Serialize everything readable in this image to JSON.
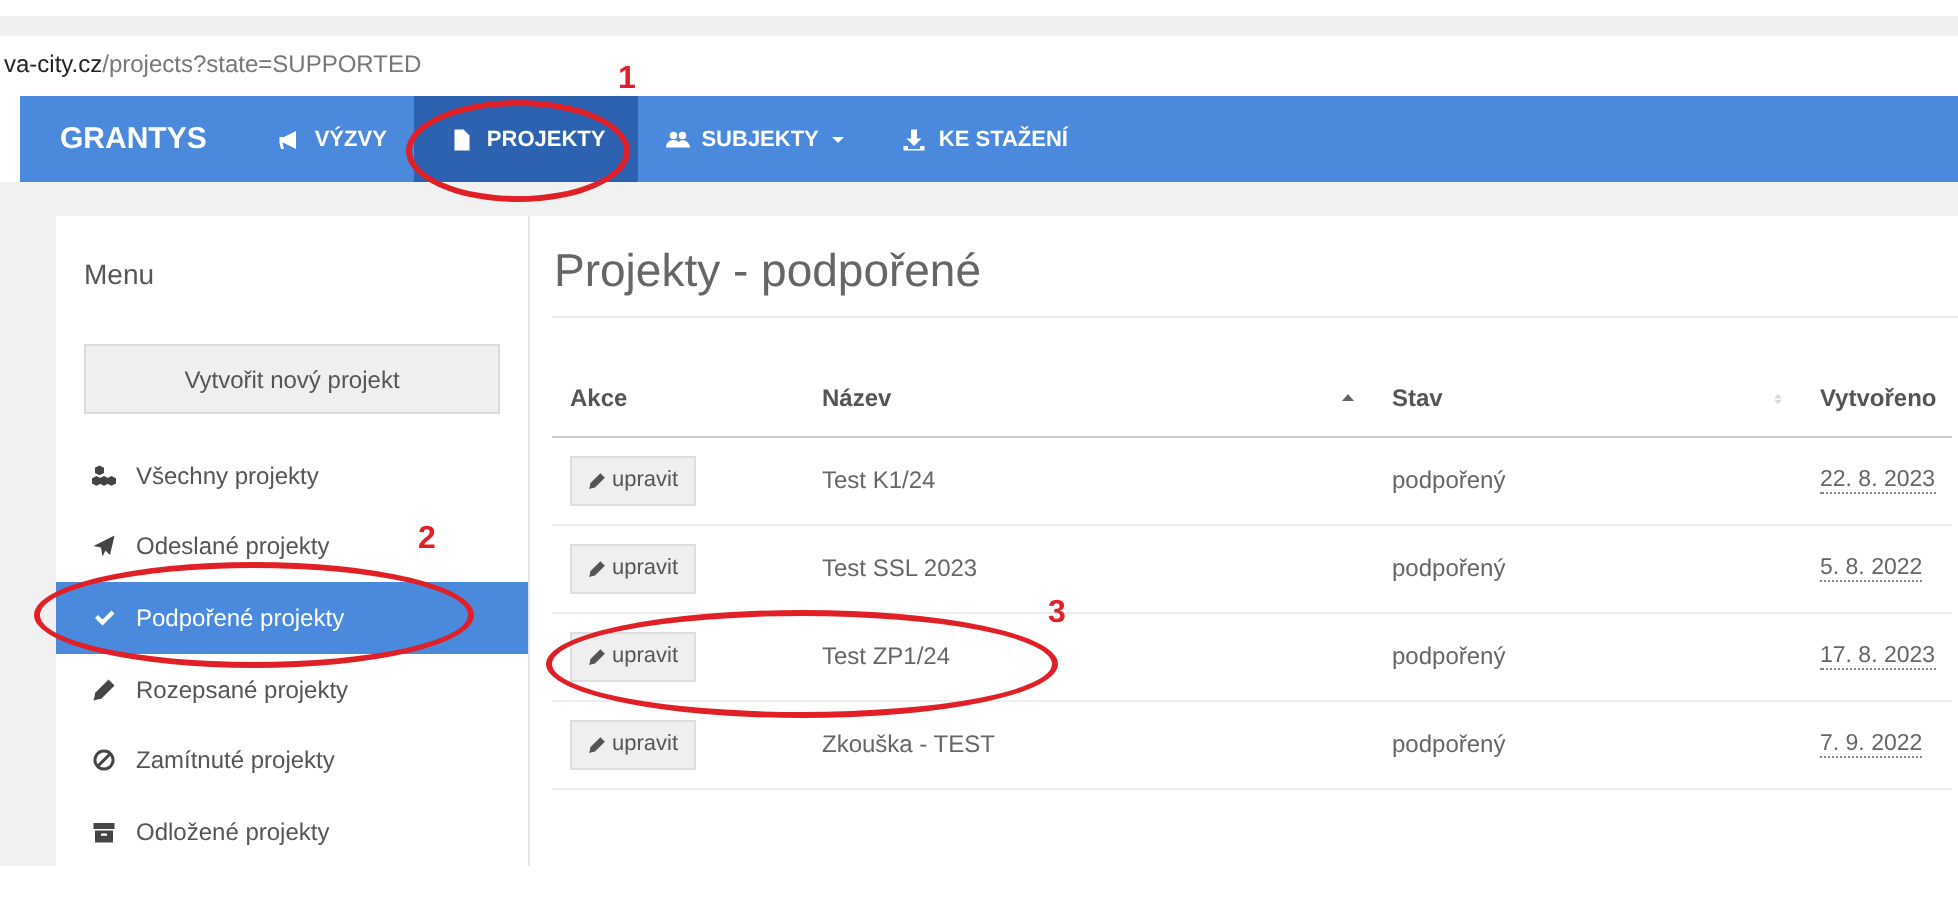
{
  "address_bar": {
    "domain": "va-city.cz",
    "path": "/projects?state=SUPPORTED"
  },
  "navbar": {
    "brand": "GRANTYS",
    "items": [
      {
        "label": "VÝZVY",
        "selected": false,
        "dropdown": false
      },
      {
        "label": "PROJEKTY",
        "selected": true,
        "dropdown": false
      },
      {
        "label": "SUBJEKTY",
        "selected": false,
        "dropdown": true
      },
      {
        "label": "KE STAŽENÍ",
        "selected": false,
        "dropdown": false
      }
    ]
  },
  "sidebar": {
    "title": "Menu",
    "new_button": "Vytvořit nový projekt",
    "items": [
      {
        "label": "Všechny projekty",
        "selected": false
      },
      {
        "label": "Odeslané projekty",
        "selected": false
      },
      {
        "label": "Podpořené projekty",
        "selected": true
      },
      {
        "label": "Rozepsané projekty",
        "selected": false
      },
      {
        "label": "Zamítnuté projekty",
        "selected": false
      },
      {
        "label": "Odložené projekty",
        "selected": false
      }
    ]
  },
  "main": {
    "heading": "Projekty - podpořené",
    "table": {
      "columns": [
        {
          "label": "Akce",
          "sorted": false,
          "sortable": false
        },
        {
          "label": "Název",
          "sorted": true,
          "sortable": true
        },
        {
          "label": "Stav",
          "sorted": false,
          "sortable": true
        },
        {
          "label": "Vytvořeno",
          "sorted": false,
          "sortable": false
        }
      ],
      "rows": [
        {
          "action": "upravit",
          "name": "Test K1/24",
          "state": "podpořený",
          "created": "22. 8. 2023"
        },
        {
          "action": "upravit",
          "name": "Test SSL 2023",
          "state": "podpořený",
          "created": "5. 8. 2022"
        },
        {
          "action": "upravit",
          "name": "Test ZP1/24",
          "state": "podpořený",
          "created": "17. 8. 2023"
        },
        {
          "action": "upravit",
          "name": "Zkouška - TEST",
          "state": "podpořený",
          "created": "7. 9. 2022"
        }
      ]
    }
  },
  "annotations": [
    {
      "label": "1"
    },
    {
      "label": "2"
    },
    {
      "label": "3"
    }
  ]
}
